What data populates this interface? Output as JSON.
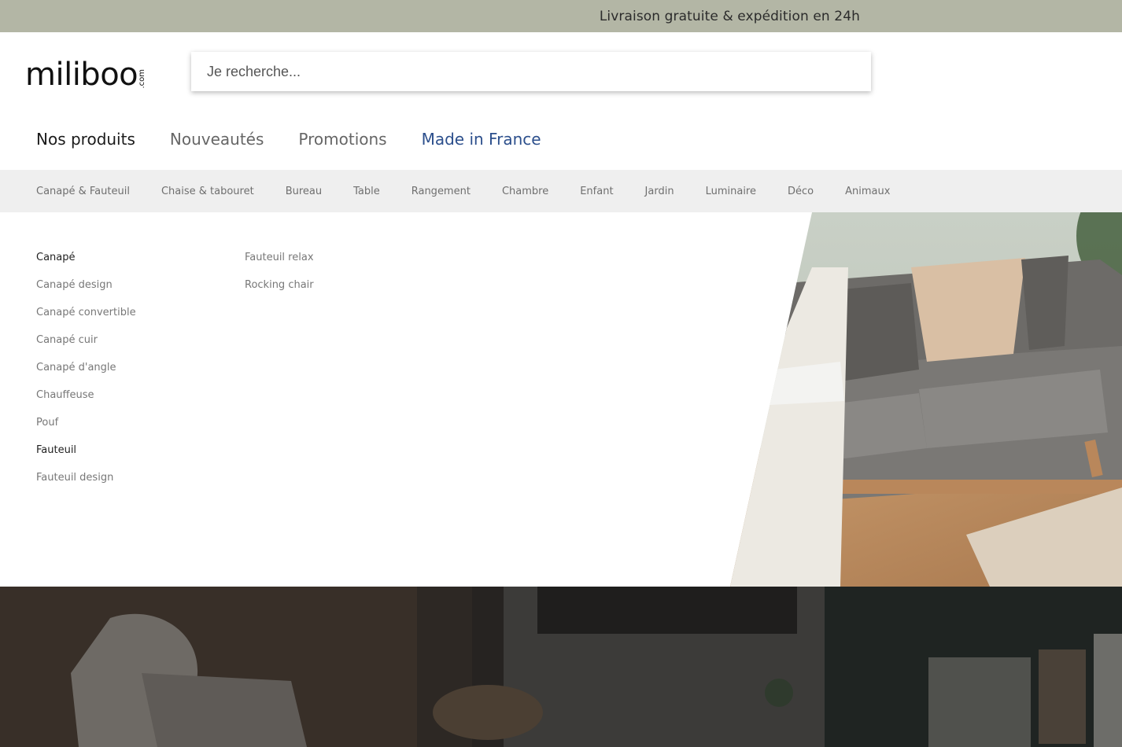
{
  "topbar": {
    "text": "Livraison gratuite & expédition en 24h"
  },
  "logo": {
    "main": "miliboo",
    "suffix": ".com"
  },
  "search": {
    "placeholder": "Je recherche..."
  },
  "main_nav": [
    {
      "label": "Nos produits",
      "state": "active"
    },
    {
      "label": "Nouveautés",
      "state": ""
    },
    {
      "label": "Promotions",
      "state": ""
    },
    {
      "label": "Made in France",
      "state": "accent"
    }
  ],
  "categories": [
    "Canapé & Fauteuil",
    "Chaise & tabouret",
    "Bureau",
    "Table",
    "Rangement",
    "Chambre",
    "Enfant",
    "Jardin",
    "Luminaire",
    "Déco",
    "Animaux"
  ],
  "dropdown": {
    "col1": [
      {
        "label": "Canapé",
        "head": true
      },
      {
        "label": "Canapé design",
        "head": false
      },
      {
        "label": "Canapé convertible",
        "head": false
      },
      {
        "label": "Canapé cuir",
        "head": false
      },
      {
        "label": "Canapé d'angle",
        "head": false
      },
      {
        "label": "Chauffeuse",
        "head": false
      },
      {
        "label": "Pouf",
        "head": false
      },
      {
        "label": "Fauteuil",
        "head": true
      },
      {
        "label": "Fauteuil design",
        "head": false
      }
    ],
    "col2": [
      {
        "label": "Fauteuil relax",
        "head": false
      },
      {
        "label": "Rocking chair",
        "head": false
      }
    ]
  },
  "colors": {
    "topbar_bg": "#b3b6a5",
    "accent": "#2c4f8c",
    "catbar_bg": "#efefef"
  },
  "icons": [
    "sofa-photo",
    "hero-photo"
  ]
}
